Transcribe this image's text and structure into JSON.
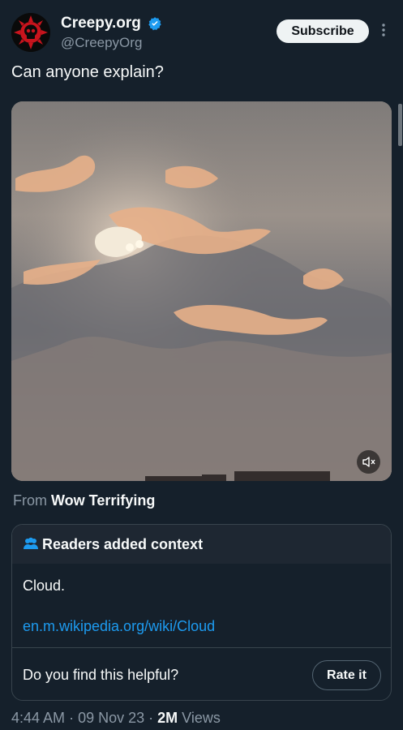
{
  "author": {
    "display_name": "Creepy.org",
    "handle": "@CreepyOrg",
    "verified": true
  },
  "actions": {
    "subscribe_label": "Subscribe",
    "more_icon": "more-vertical-icon"
  },
  "tweet": {
    "text": "Can anyone explain?",
    "media_icon": "mute-icon"
  },
  "source": {
    "prefix": "From",
    "name": "Wow Terrifying"
  },
  "context_note": {
    "title": "Readers added context",
    "body": "Cloud.",
    "link": "en.m.wikipedia.org/wiki/Cloud",
    "helpful_prompt": "Do you find this helpful?",
    "rate_label": "Rate it"
  },
  "meta": {
    "time": "4:44 AM",
    "date": "09 Nov 23",
    "views_count": "2M",
    "views_label": "Views"
  },
  "colors": {
    "background": "#15202b",
    "accent": "#1d9bf0",
    "secondary_text": "#8b98a5",
    "border": "#38444d"
  }
}
